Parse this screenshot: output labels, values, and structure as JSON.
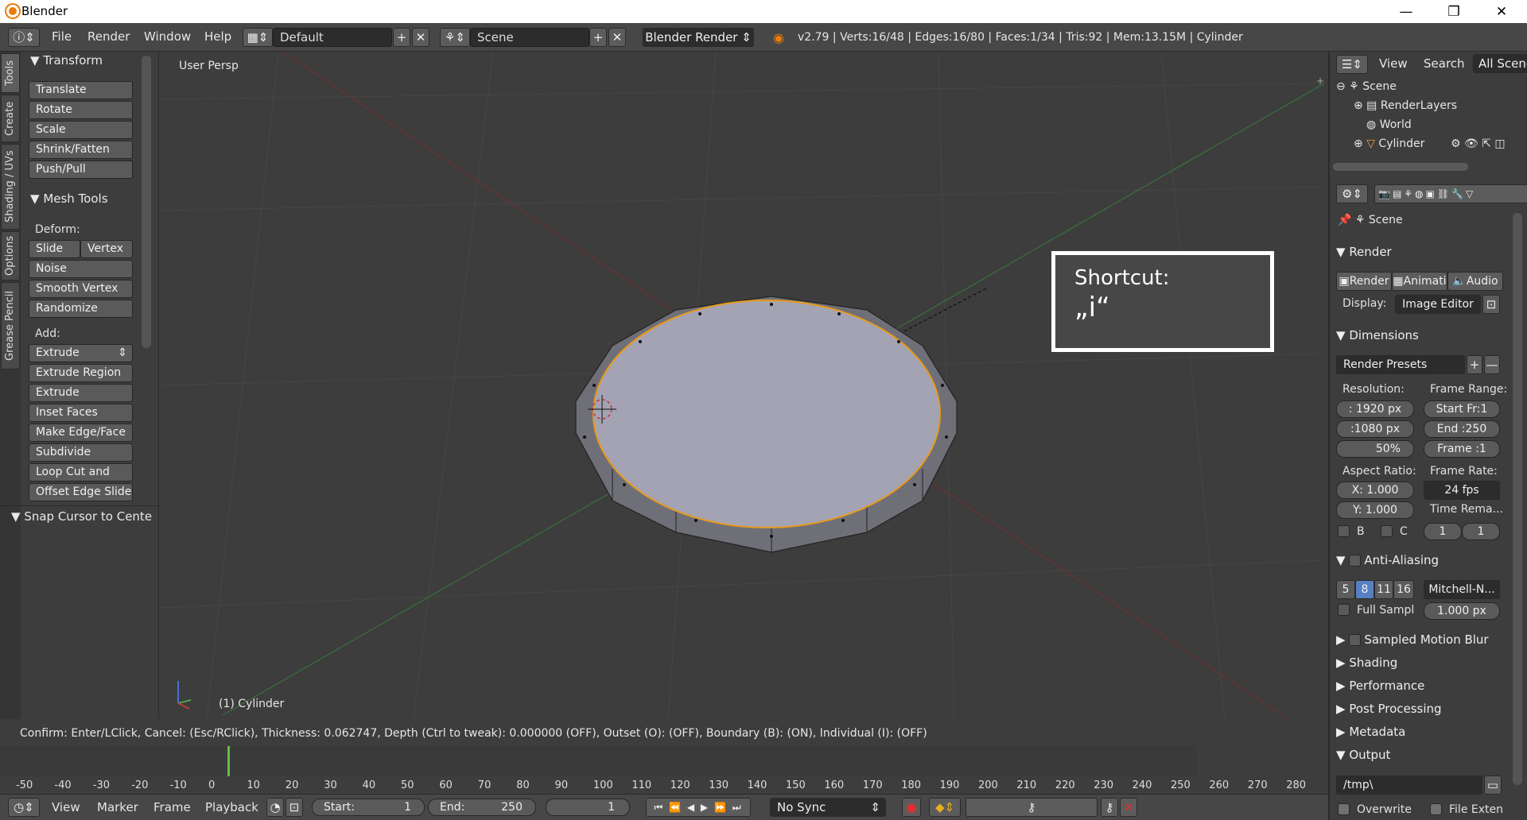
{
  "window": {
    "title": "Blender",
    "minimize": "—",
    "maximize": "❐",
    "close": "✕"
  },
  "info": {
    "menus": [
      "File",
      "Render",
      "Window",
      "Help"
    ],
    "layout": "Default",
    "scene": "Scene",
    "engine": "Blender Render",
    "stats": "v2.79 | Verts:16/48 | Edges:16/80 | Faces:1/34 | Tris:92 | Mem:13.15M | Cylinder"
  },
  "tabs": [
    "Tools",
    "Create",
    "Shading / UVs",
    "Options",
    "Grease Pencil"
  ],
  "toolshelf": {
    "transform_title": "Transform",
    "transform_buttons": [
      "Translate",
      "Rotate",
      "Scale",
      "Shrink/Fatten",
      "Push/Pull"
    ],
    "mesh_tools_title": "Mesh Tools",
    "deform_label": "Deform:",
    "slide_edge": "Slide Ed",
    "vertex": "Vertex",
    "deform_buttons": [
      "Noise",
      "Smooth Vertex",
      "Randomize"
    ],
    "add_label": "Add:",
    "extrude": "Extrude",
    "add_buttons": [
      "Extrude Region",
      "Extrude Individual",
      "Inset Faces",
      "Make Edge/Face",
      "Subdivide",
      "Loop Cut and Sli...",
      "Offset Edge Slide"
    ],
    "snap_title": "Snap Cursor to Cente"
  },
  "viewport": {
    "label": "User Persp",
    "object_label": "(1) Cylinder"
  },
  "shortcut": {
    "title": "Shortcut:",
    "key": "„i“"
  },
  "status": "Confirm: Enter/LClick, Cancel: (Esc/RClick), Thickness: 0.062747, Depth (Ctrl to tweak): 0.000000 (OFF), Outset (O): (OFF), Boundary (B): (ON), Individual (I): (OFF)",
  "timeline": {
    "ticks": [
      "-50",
      "-40",
      "-30",
      "-20",
      "-10",
      "0",
      "10",
      "20",
      "30",
      "40",
      "50",
      "60",
      "70",
      "80",
      "90",
      "100",
      "110",
      "120",
      "130",
      "140",
      "150",
      "160",
      "170",
      "180",
      "190",
      "200",
      "210",
      "220",
      "230",
      "240",
      "250",
      "260",
      "270",
      "280"
    ],
    "menus": [
      "View",
      "Marker",
      "Frame",
      "Playback"
    ],
    "start_label": "Start:",
    "start": "1",
    "end_label": "End:",
    "end": "250",
    "current": "1",
    "sync": "No Sync"
  },
  "outliner": {
    "view": "View",
    "search": "Search",
    "all_scenes": "All Scenes",
    "items": [
      "Scene",
      "RenderLayers",
      "World",
      "Cylinder"
    ]
  },
  "properties": {
    "scene": "Scene",
    "render_title": "Render",
    "render_btn": "Render",
    "anim_btn": "Animati",
    "audio_btn": "Audio",
    "display_label": "Display:",
    "display_value": "Image Editor",
    "dimensions_title": "Dimensions",
    "presets": "Render Presets",
    "resolution_label": "Resolution:",
    "res_x": ": 1920 px",
    "res_y": ":1080 px",
    "res_pct": "50%",
    "frame_range_label": "Frame Range:",
    "start_fr": "Start Fr:1",
    "end_fr": "End :250",
    "frame": "Frame :1",
    "aspect_label": "Aspect Ratio:",
    "asp_x": "X:  1.000",
    "asp_y": "Y:  1.000",
    "frame_rate_label": "Frame Rate:",
    "fps": "24 fps",
    "time_remap": "Time Rema...",
    "b_label": "B",
    "c_label": "C",
    "tr1": "1",
    "tr2": "1",
    "aa_title": "Anti-Aliasing",
    "aa_samples": [
      "5",
      "8",
      "11",
      "16"
    ],
    "aa_filter": "Mitchell-N...",
    "full_sample": "Full Sampl",
    "filter_size": "1.000 px",
    "collapsed": [
      "Sampled Motion Blur",
      "Shading",
      "Performance",
      "Post Processing",
      "Metadata"
    ],
    "output_title": "Output",
    "output_path": "/tmp\\",
    "overwrite": "Overwrite",
    "file_ext": "File Exten"
  }
}
